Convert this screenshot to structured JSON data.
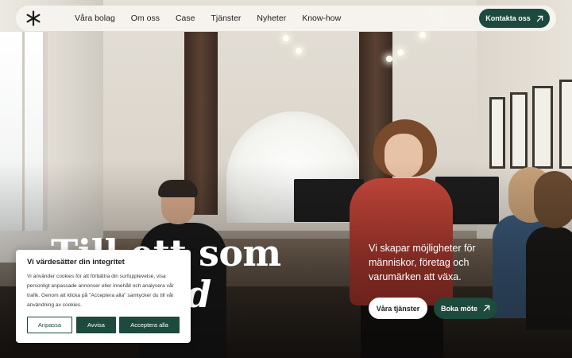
{
  "nav": {
    "logo_icon": "asterisk-logo-icon",
    "links": [
      "Våra bolag",
      "Om oss",
      "Case",
      "Tjänster",
      "Nyheter",
      "Know-how"
    ],
    "contact_label": "Kontakta oss",
    "contact_icon": "arrow-up-right-icon"
  },
  "hero": {
    "headline_line1": "Till ett som",
    "headline_line2": "skillnad",
    "tagline": "Vi skapar möjligheter för människor, företag och varumärken att växa.",
    "services_label": "Våra tjänster",
    "book_label": "Boka möte",
    "book_icon": "arrow-up-right-icon"
  },
  "cookie": {
    "title": "Vi värdesätter din integritet",
    "text": "Vi använder cookies för att förbättra din surfupplevelse, visa personligt anpassade annonser eller innehåll och analysera vår trafik. Genom att klicka på \"Acceptera alla\" samtycker du till vår användning av cookies.",
    "adjust_label": "Anpassa",
    "deny_label": "Avvisa",
    "accept_label": "Acceptera alla"
  },
  "colors": {
    "brand_green": "#1c4a3c",
    "nav_background": "#f6f4f0",
    "text_dark": "#1d1d1b"
  }
}
